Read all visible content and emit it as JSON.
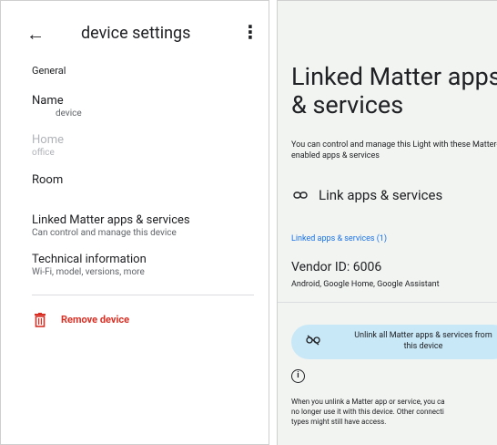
{
  "left": {
    "title": "device settings",
    "section": "General",
    "name": {
      "title": "Name",
      "value": "device"
    },
    "home": {
      "title": "Home",
      "value": "office"
    },
    "room": {
      "title": "Room"
    },
    "linked": {
      "title": "Linked Matter apps & services",
      "sub": "Can control and manage this device"
    },
    "tech": {
      "title": "Technical information",
      "sub": "Wi-Fi, model, versions, more"
    },
    "remove_label": "Remove device"
  },
  "right": {
    "title_line1": "Linked Matter apps",
    "title_line2": "& services",
    "desc": "You can control and manage this Light with these Matter-enabled apps & services",
    "link_label": "Link apps & services",
    "linked_count": "Linked apps & services (1)",
    "vendor": "Vendor ID: 6006",
    "vendor_sub": "Android, Google Home, Google Assistant",
    "unlink_label": "Unlink all Matter apps & services from\nthis device",
    "footnote": "When you unlink a Matter app or service, you ca\nno longer use it with this device. Other connecti\ntypes might still have access."
  },
  "colors": {
    "accent_blue": "#1a73e8",
    "danger_red": "#d93025",
    "unlink_bg": "#c8e8f8"
  }
}
